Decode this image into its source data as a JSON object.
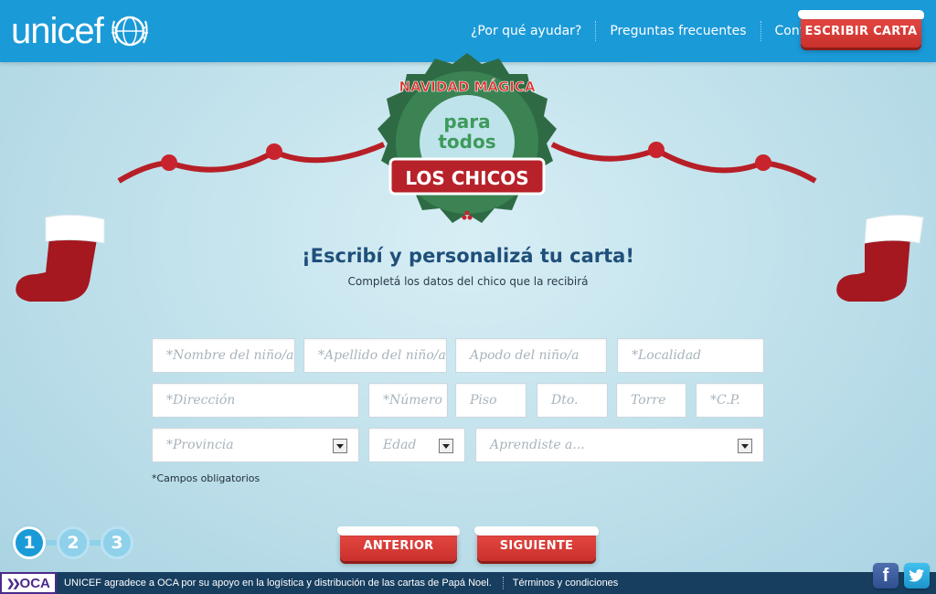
{
  "header": {
    "logo_text": "unicef",
    "nav": [
      {
        "label": "¿Por qué ayudar?"
      },
      {
        "label": "Preguntas frecuentes"
      },
      {
        "label": "Contacto"
      }
    ],
    "cta_label": "ESCRIBIR CARTA"
  },
  "badge": {
    "line1": "NAVIDAD MÁGICA",
    "line2": "para",
    "line3": "todos",
    "line4": "LOS CHICOS"
  },
  "main": {
    "title": "¡Escribí y personalizá tu carta!",
    "subtitle": "Completá los datos del chico que la recibirá"
  },
  "form": {
    "nombre_placeholder": "*Nombre del niño/a",
    "apellido_placeholder": "*Apellido del niño/a",
    "apodo_placeholder": "Apodo del niño/a",
    "localidad_placeholder": "*Localidad",
    "direccion_placeholder": "*Dirección",
    "numero_placeholder": "*Número",
    "piso_placeholder": "Piso",
    "dto_placeholder": "Dto.",
    "torre_placeholder": "Torre",
    "cp_placeholder": "*C.P.",
    "provincia_value": "*Provincia",
    "edad_value": "Edad",
    "aprendiste_value": "Aprendiste a...",
    "required_note": "*Campos obligatorios"
  },
  "steps": {
    "items": [
      "1",
      "2",
      "3"
    ],
    "active": "1"
  },
  "nav_buttons": {
    "prev_label": "ANTERIOR",
    "next_label": "SIGUIENTE"
  },
  "footer": {
    "oca_logo": "OCA",
    "thanks_text": "UNICEF agradece a OCA por su apoyo en la logística y distribución de las cartas de Papá Noel.",
    "terms_label": "Términos y condiciones",
    "facebook_glyph": "f",
    "twitter_glyph": "t"
  },
  "colors": {
    "header_blue": "#1b9ad8",
    "button_red": "#d33b36",
    "footer_navy": "#173e5f",
    "badge_green": "#2e6b45"
  }
}
